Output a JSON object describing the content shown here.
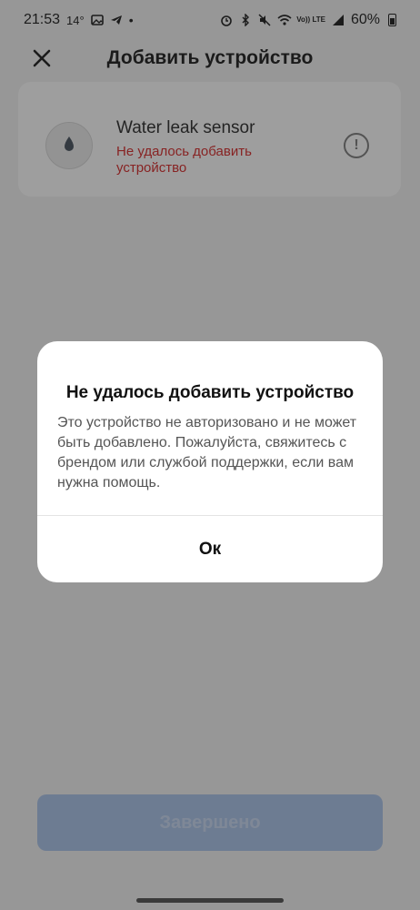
{
  "status_bar": {
    "time": "21:53",
    "temperature": "14°",
    "lte_label": "Vo)) LTE",
    "battery": "60%"
  },
  "app_bar": {
    "title": "Добавить устройство",
    "close_icon": "close-icon"
  },
  "device": {
    "name": "Water leak sensor",
    "error": "Не удалось добавить устройство",
    "icon": "water-drop-icon"
  },
  "done_button": {
    "label": "Завершено"
  },
  "dialog": {
    "title": "Не удалось добавить устройство",
    "message": "Это устройство не авторизовано и не может быть добавлено. Пожалуйста, свяжитесь с брендом или службой поддержки, если вам нужна помощь.",
    "ok_label": "Ок"
  },
  "colors": {
    "error": "#d62020",
    "primary_disabled": "#a6c2ea",
    "scrim": "rgba(40,40,40,0.45)"
  }
}
